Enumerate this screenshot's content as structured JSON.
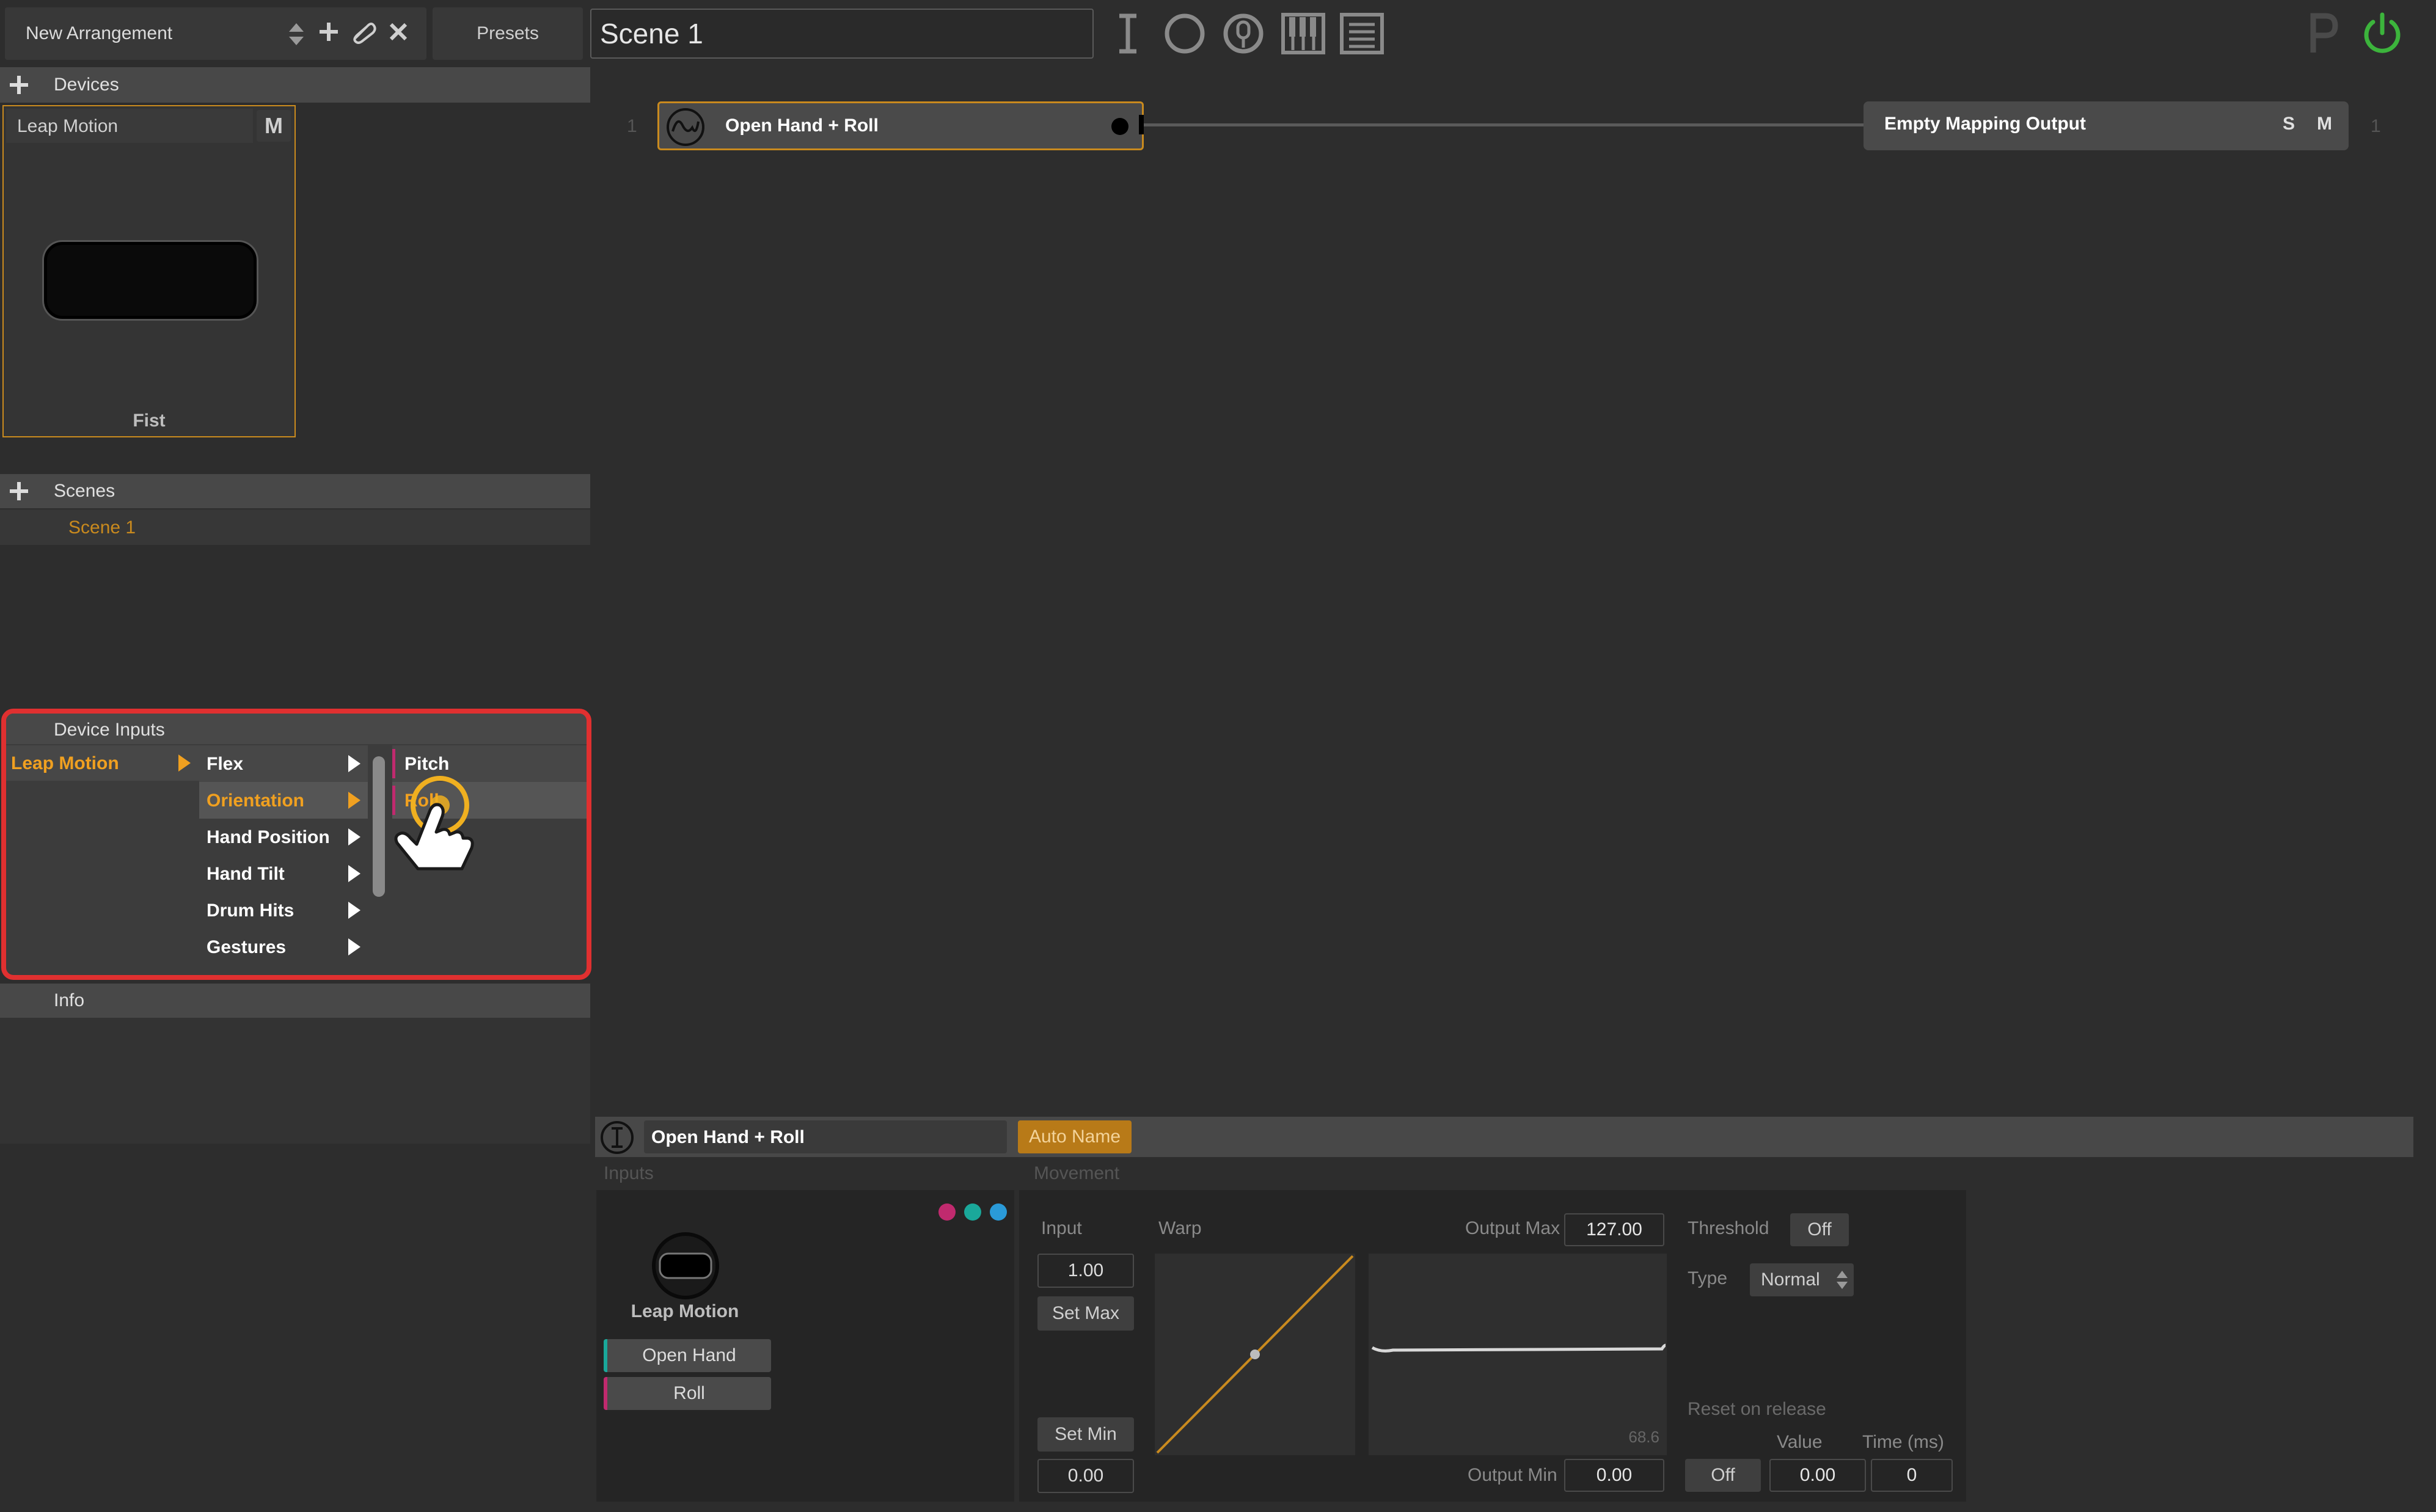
{
  "toolbar": {
    "arrangement_name": "New Arrangement",
    "presets_label": "Presets",
    "scene_title": "Scene 1",
    "icons": [
      "text-cursor-icon",
      "circle-icon",
      "mic-icon",
      "piano-icon",
      "list-icon",
      "p-icon",
      "power-icon"
    ]
  },
  "devices": {
    "header": "Devices",
    "card": {
      "name": "Leap Motion",
      "mute_label": "M",
      "gesture": "Fist"
    }
  },
  "scenes": {
    "header": "Scenes",
    "items": [
      "Scene 1"
    ]
  },
  "device_inputs": {
    "header": "Device Inputs",
    "device": "Leap Motion",
    "categories": [
      "Flex",
      "Orientation",
      "Hand Position",
      "Hand Tilt",
      "Drum Hits",
      "Gestures"
    ],
    "selected_category": "Orientation",
    "sub_items": [
      "Pitch",
      "Roll"
    ],
    "highlight_color": "#e03030"
  },
  "info": {
    "header": "Info"
  },
  "canvas": {
    "row_number_left": "1",
    "row_number_right": "1",
    "input_node_label": "Open Hand + Roll",
    "output_node_label": "Empty Mapping Output",
    "output_solo": "S",
    "output_mute": "M"
  },
  "inspector": {
    "mapping_name": "Open Hand + Roll",
    "auto_name_label": "Auto Name",
    "inputs_label": "Inputs",
    "movement_label": "Movement",
    "device_name": "Leap Motion",
    "input_tags": [
      {
        "label": "Open Hand",
        "color": "#1aa89a"
      },
      {
        "label": "Roll",
        "color": "#c02a6e"
      }
    ],
    "dot_colors": [
      "#c02a6e",
      "#1aa89a",
      "#2a9ad8"
    ],
    "input_label": "Input",
    "input_value": "1.00",
    "set_max_label": "Set Max",
    "set_min_label": "Set Min",
    "min_value": "0.00",
    "warp_label": "Warp",
    "output_max_label": "Output Max",
    "output_max_value": "127.00",
    "output_min_label": "Output Min",
    "output_min_value": "0.00",
    "output_readout": "68.6",
    "threshold_label": "Threshold",
    "threshold_value": "Off",
    "type_label": "Type",
    "type_value": "Normal",
    "reset_label": "Reset on release",
    "reset_value_label": "Value",
    "reset_time_label": "Time (ms)",
    "reset_state": "Off",
    "reset_value": "0.00",
    "reset_time": "0"
  },
  "accent_color": "#f0a020"
}
